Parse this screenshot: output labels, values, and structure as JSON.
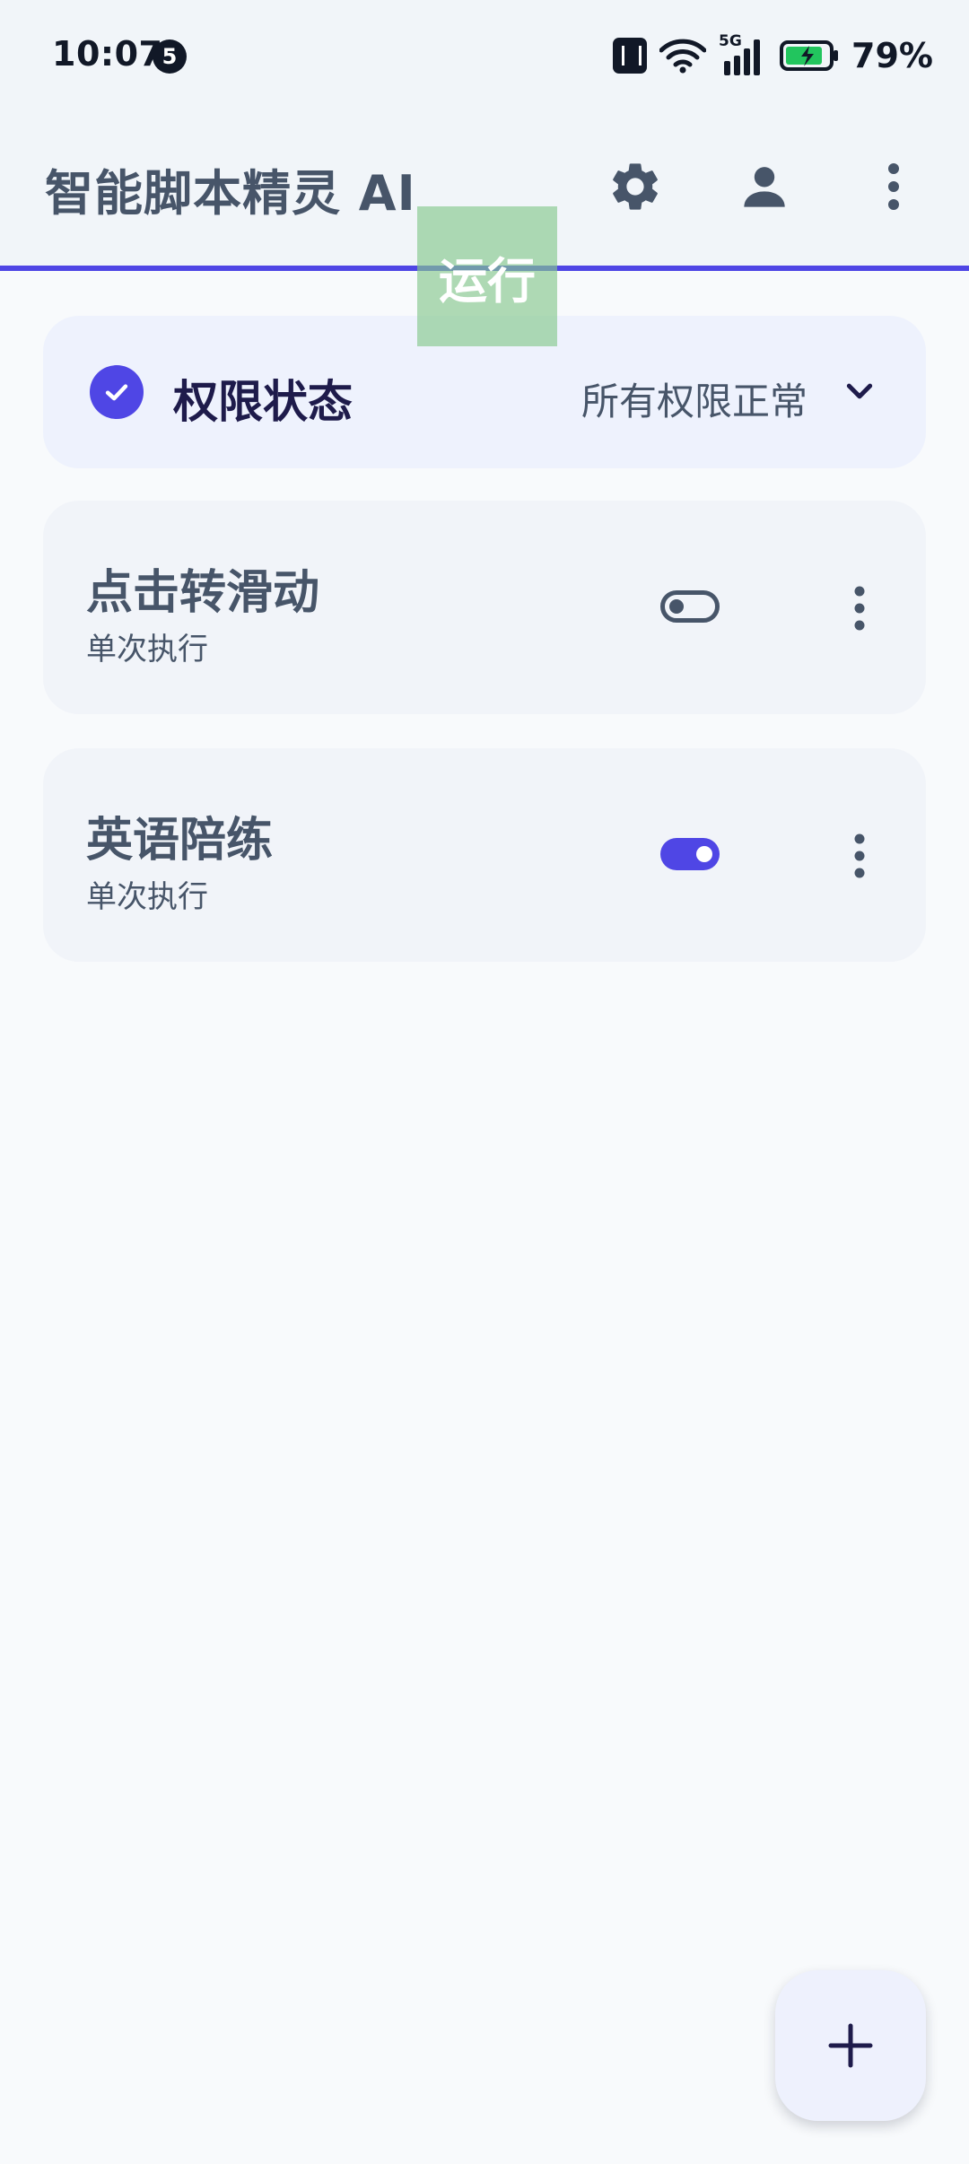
{
  "status_bar": {
    "time": "10:07",
    "notification_count": "5",
    "network": "5G",
    "battery": "79%"
  },
  "app_bar": {
    "title": "智能脚本精灵 AI",
    "icons": [
      "gear-icon",
      "person-icon",
      "more-vert-icon"
    ]
  },
  "overlay": {
    "run_label": "运行"
  },
  "permission": {
    "title": "权限状态",
    "status": "所有权限正常"
  },
  "scripts": [
    {
      "name": "点击转滑动",
      "mode": "单次执行",
      "enabled": false
    },
    {
      "name": "英语陪练",
      "mode": "单次执行",
      "enabled": true
    }
  ],
  "colors": {
    "accent": "#4f46e5",
    "text_primary": "#475569",
    "background": "#f8fafc",
    "overlay": "#86c88d"
  }
}
